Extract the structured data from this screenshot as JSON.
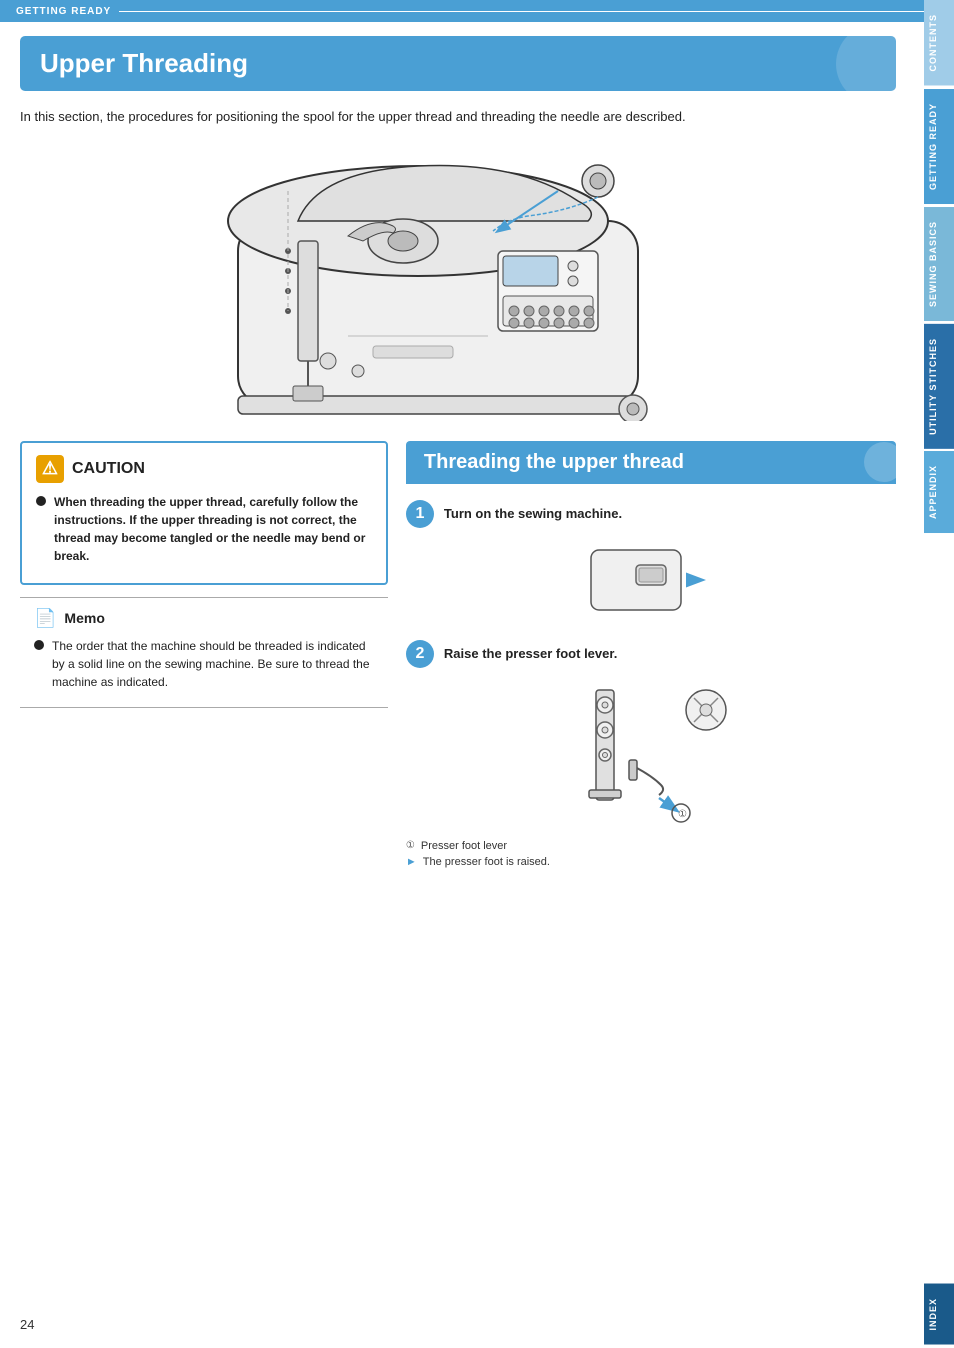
{
  "header": {
    "section_label": "GETTING READY",
    "line": true
  },
  "page_title": "Upper Threading",
  "intro": "In this section, the procedures for positioning the spool for the upper thread and threading the needle are described.",
  "sidebar_tabs": [
    {
      "id": "contents",
      "label": "CONTENTS",
      "style": "light"
    },
    {
      "id": "getting-ready",
      "label": "GETTING READY",
      "style": "active"
    },
    {
      "id": "sewing-basics",
      "label": "SEWING BASICS",
      "style": "normal"
    },
    {
      "id": "utility-stitches",
      "label": "UTILITY STITCHES",
      "style": "dark"
    },
    {
      "id": "appendix",
      "label": "APPENDIX",
      "style": "normal"
    },
    {
      "id": "index",
      "label": "INDEX",
      "style": "index"
    }
  ],
  "caution": {
    "title": "CAUTION",
    "items": [
      "When threading the upper thread, carefully follow the instructions. If the upper threading is not correct, the thread may become tangled or the needle may bend or break."
    ]
  },
  "memo": {
    "title": "Memo",
    "items": [
      "The order that the machine should be threaded is indicated by a solid line on the sewing machine. Be sure to thread the machine as indicated."
    ]
  },
  "threading_section": {
    "title": "Threading the upper thread",
    "steps": [
      {
        "number": "1",
        "instruction": "Turn on the sewing machine."
      },
      {
        "number": "2",
        "instruction": "Raise the presser foot lever.",
        "footnotes": [
          {
            "marker": "①",
            "text": "Presser foot lever"
          }
        ],
        "result": "The presser foot is raised."
      }
    ]
  },
  "page_number": "24"
}
